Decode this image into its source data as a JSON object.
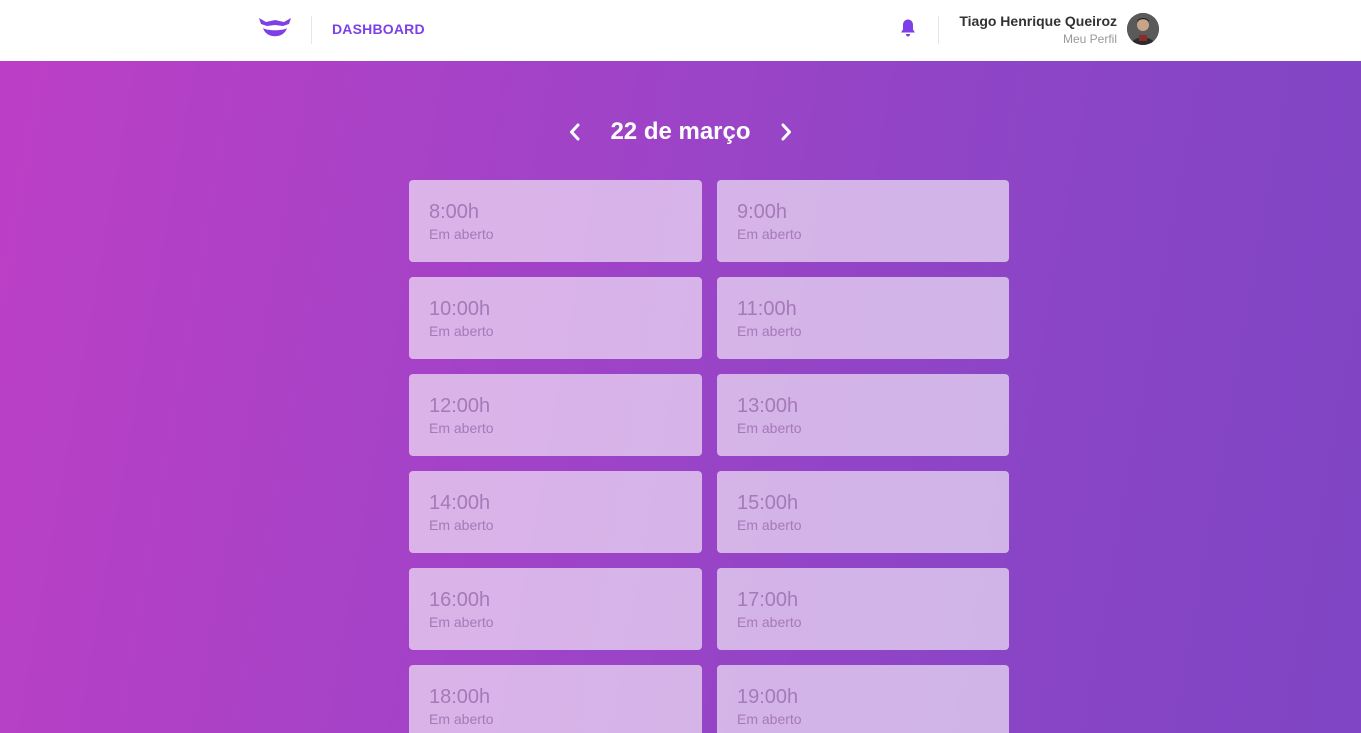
{
  "header": {
    "brand": "DASHBOARD",
    "profile": {
      "name": "Tiago Henrique Queiroz",
      "link": "Meu Perfil"
    }
  },
  "icons": {
    "logo": "barber-mustache-logo-icon",
    "notifications": "bell-icon",
    "prev": "chevron-left-icon",
    "next": "chevron-right-icon",
    "avatar": "user-avatar"
  },
  "colors": {
    "accent": "#7d40e7",
    "gradient_start": "#bc3fc6",
    "gradient_end": "#7f45c4",
    "slot_text": "#a57ab8"
  },
  "schedule": {
    "date": "22 de março",
    "slots": [
      {
        "time": "8:00h",
        "status": "Em aberto"
      },
      {
        "time": "9:00h",
        "status": "Em aberto"
      },
      {
        "time": "10:00h",
        "status": "Em aberto"
      },
      {
        "time": "11:00h",
        "status": "Em aberto"
      },
      {
        "time": "12:00h",
        "status": "Em aberto"
      },
      {
        "time": "13:00h",
        "status": "Em aberto"
      },
      {
        "time": "14:00h",
        "status": "Em aberto"
      },
      {
        "time": "15:00h",
        "status": "Em aberto"
      },
      {
        "time": "16:00h",
        "status": "Em aberto"
      },
      {
        "time": "17:00h",
        "status": "Em aberto"
      },
      {
        "time": "18:00h",
        "status": "Em aberto"
      },
      {
        "time": "19:00h",
        "status": "Em aberto"
      }
    ]
  }
}
